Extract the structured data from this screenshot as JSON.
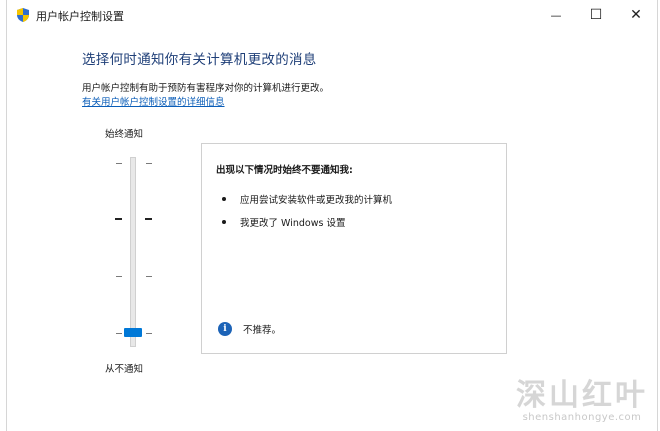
{
  "window": {
    "title": "用户帐户控制设置",
    "minimize_glyph": "—",
    "maximize_glyph": "☐",
    "close_glyph": "✕"
  },
  "main": {
    "heading": "选择何时通知你有关计算机更改的消息",
    "description": "用户帐户控制有助于预防有害程序对你的计算机进行更改。",
    "link": "有关用户帐户控制设置的详细信息"
  },
  "slider": {
    "top_label": "始终通知",
    "bottom_label": "从不通知",
    "level_count": 4,
    "selected_level": 1,
    "accent_color": "#0078d7"
  },
  "panel": {
    "title": "出现以下情况时始终不要通知我:",
    "bullets": [
      "应用尝试安装软件或更改我的计算机",
      "我更改了 Windows 设置"
    ],
    "info_text": "不推荐。",
    "info_icon": "info-icon"
  },
  "watermark": {
    "big": "深山红叶",
    "small": "shenshanhongye.com"
  },
  "colors": {
    "heading": "#1f3f78",
    "link": "#0a5db8"
  }
}
